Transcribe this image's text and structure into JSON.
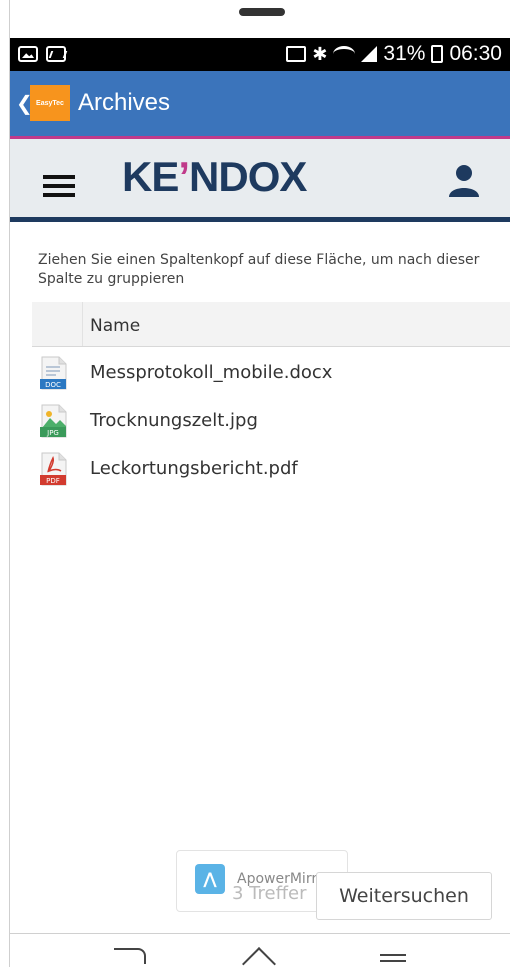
{
  "statusbar": {
    "battery_percent": "31%",
    "time": "06:30"
  },
  "appbar": {
    "back_chevron": "❮",
    "logo_text": "EasyTec",
    "title": "Archives"
  },
  "header": {
    "brand_part1": "KE",
    "brand_apostrophe": "’",
    "brand_part2": "NDOX"
  },
  "hint": "Ziehen Sie einen Spaltenkopf auf diese Fläche, um nach dieser Spalte zu gruppieren",
  "grid": {
    "column_name": "Name",
    "rows": [
      {
        "name": "Messprotokoll_mobile.docx",
        "type": "DOC",
        "icon": "doc-file-icon"
      },
      {
        "name": "Trocknungszelt.jpg",
        "type": "JPG",
        "icon": "jpg-file-icon"
      },
      {
        "name": "Leckortungsbericht.pdf",
        "type": "PDF",
        "icon": "pdf-file-icon"
      }
    ]
  },
  "toast": {
    "text": "ApowerMirror"
  },
  "footer": {
    "hits_text": "3 Treffer",
    "search_more_label": "Weitersuchen"
  }
}
